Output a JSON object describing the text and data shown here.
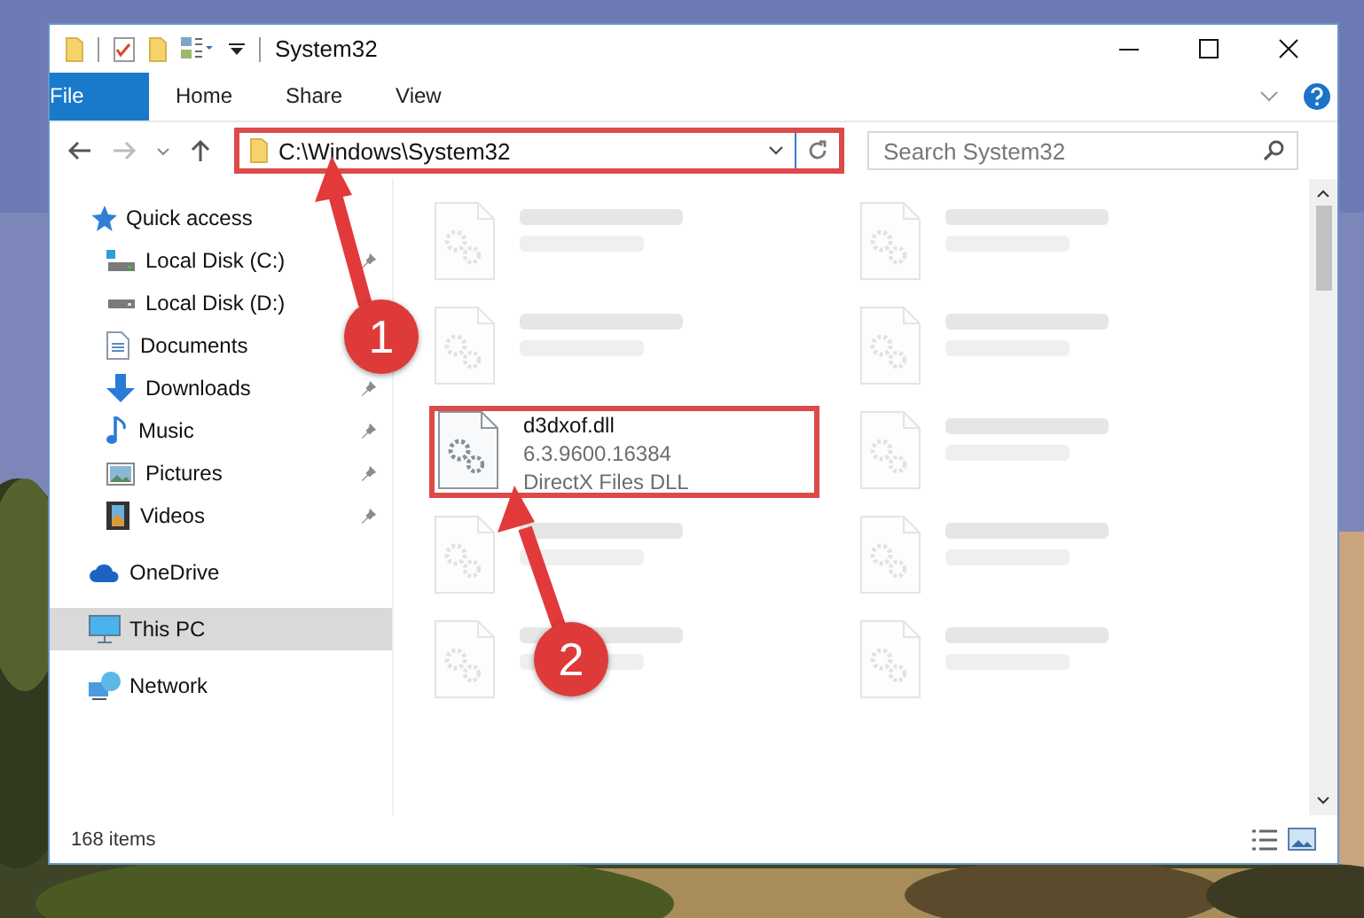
{
  "window": {
    "title": "System32"
  },
  "ribbon_tabs": [
    {
      "label": "File",
      "kind": "file"
    },
    {
      "label": "Home",
      "kind": "tab"
    },
    {
      "label": "Share",
      "kind": "tab"
    },
    {
      "label": "View",
      "kind": "tab"
    }
  ],
  "address_bar": {
    "path": "C:\\Windows\\System32",
    "highlighted": true
  },
  "search": {
    "placeholder": "Search System32"
  },
  "sidebar": {
    "items": [
      {
        "label": "Quick access",
        "selected": false,
        "children": [
          {
            "label": "Local Disk (C:)",
            "pinned": true
          },
          {
            "label": "Local Disk (D:)"
          },
          {
            "label": "Documents"
          },
          {
            "label": "Downloads",
            "pinned": true
          },
          {
            "label": "Music",
            "pinned": true
          },
          {
            "label": "Pictures",
            "pinned": true
          },
          {
            "label": "Videos",
            "pinned": true
          }
        ]
      },
      {
        "label": "OneDrive",
        "selected": false
      },
      {
        "label": "This PC",
        "selected": true
      },
      {
        "label": "Network",
        "selected": false
      }
    ]
  },
  "files": [
    {
      "highlighted": false
    },
    {
      "highlighted": false
    },
    {
      "highlighted": false
    },
    {
      "highlighted": false
    },
    {
      "highlighted": true,
      "name": "d3dxof.dll",
      "details": [
        "6.3.9600.16384",
        "DirectX Files DLL"
      ]
    },
    {
      "highlighted": false
    },
    {
      "highlighted": false
    },
    {
      "highlighted": false
    },
    {
      "highlighted": false
    },
    {
      "highlighted": false
    }
  ],
  "status_bar": {
    "item_count": "168 items"
  },
  "annotations": [
    {
      "label": "1"
    },
    {
      "label": "2"
    }
  ]
}
